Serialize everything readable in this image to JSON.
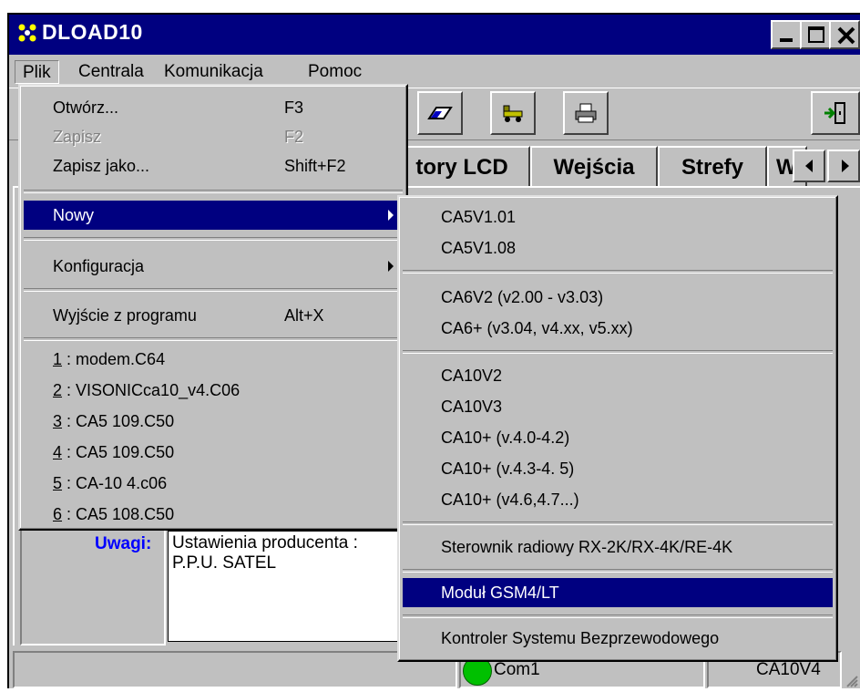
{
  "window": {
    "title": "DLOAD10"
  },
  "menubar": [
    "Plik",
    "Centrala",
    "Komunikacja",
    "Pomoc"
  ],
  "tabs": [
    "tory LCD",
    "Wejścia",
    "Strefy",
    "W"
  ],
  "notes": {
    "label": "Uwagi:",
    "line1": "Ustawienia producenta :",
    "line2": "P.P.U. SATEL"
  },
  "statusbar": {
    "port": "Com1",
    "model": "CA10V4"
  },
  "plik_menu": {
    "open": {
      "label": "Otwórz...",
      "shortcut": "F3"
    },
    "save": {
      "label": "Zapisz",
      "shortcut": "F2"
    },
    "save_as": {
      "label": "Zapisz jako...",
      "shortcut": "Shift+F2"
    },
    "new": {
      "label": "Nowy"
    },
    "config": {
      "label": "Konfiguracja"
    },
    "exit": {
      "label": "Wyjście z programu",
      "shortcut": "Alt+X"
    },
    "recent": [
      {
        "num": "1",
        "name": ": modem.C64"
      },
      {
        "num": "2",
        "name": ": VISONICca10_v4.C06"
      },
      {
        "num": "3",
        "name": ": CA5 109.C50"
      },
      {
        "num": "4",
        "name": ": CA5 109.C50"
      },
      {
        "num": "5",
        "name": ": CA-10 4.c06"
      },
      {
        "num": "6",
        "name": ": CA5 108.C50"
      }
    ]
  },
  "nowy_submenu": [
    "CA5V1.01",
    "CA5V1.08",
    "CA6V2 (v2.00 - v3.03)",
    "CA6+ (v3.04, v4.xx, v5.xx)",
    "CA10V2",
    "CA10V3",
    "CA10+ (v.4.0-4.2)",
    "CA10+ (v.4.3-4. 5)",
    "CA10+ (v4.6,4.7...)",
    "Sterownik radiowy RX-2K/RX-4K/RE-4K",
    "Moduł GSM4/LT",
    "Kontroler Systemu Bezprzewodowego"
  ],
  "colors": {
    "titlebar": "#000080",
    "face": "#c0c0c0",
    "highlight": "#000080",
    "status_led": "#00c000"
  },
  "icons": [
    "app-icon",
    "minimize-icon",
    "maximize-icon",
    "close-icon",
    "eraser-icon",
    "truck-icon",
    "printer-icon",
    "exit-door-icon",
    "arrow-left-icon",
    "arrow-right-icon",
    "submenu-arrow-icon"
  ]
}
